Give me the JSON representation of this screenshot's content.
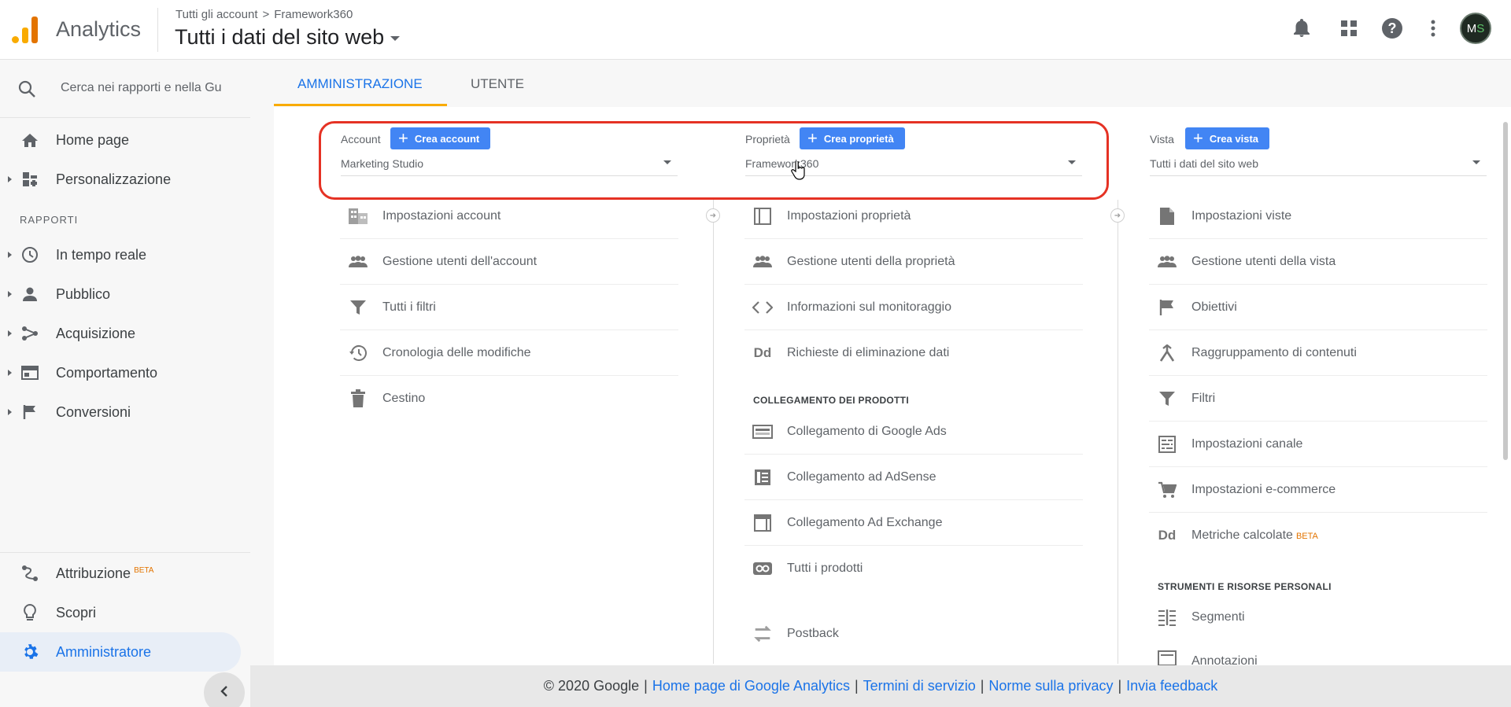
{
  "header": {
    "app_name": "Analytics",
    "breadcrumb": [
      "Tutti gli account",
      "Framework360"
    ],
    "breadcrumb_sep": ">",
    "view_title": "Tutti i dati del sito web",
    "avatar_initials": "M",
    "avatar_initials_2": "S",
    "icons": [
      "bell-icon",
      "apps-grid-icon",
      "help-icon",
      "more-vert-icon"
    ]
  },
  "sidebar": {
    "search_placeholder": "Cerca nei rapporti e nella Gu",
    "items_top": [
      {
        "label": "Home page",
        "icon": "home-icon"
      },
      {
        "label": "Personalizzazione",
        "icon": "dashboard-icon"
      }
    ],
    "section_label": "RAPPORTI",
    "items_reports": [
      {
        "label": "In tempo reale",
        "icon": "clock-icon"
      },
      {
        "label": "Pubblico",
        "icon": "person-icon"
      },
      {
        "label": "Acquisizione",
        "icon": "acquisition-icon"
      },
      {
        "label": "Comportamento",
        "icon": "behavior-icon"
      },
      {
        "label": "Conversioni",
        "icon": "flag-icon"
      }
    ],
    "items_bottom": [
      {
        "label": "Attribuzione",
        "badge": "BETA",
        "icon": "attribution-icon"
      },
      {
        "label": "Scopri",
        "icon": "lightbulb-icon"
      },
      {
        "label": "Amministratore",
        "icon": "gear-icon",
        "active": true
      }
    ]
  },
  "tabs": [
    {
      "label": "AMMINISTRAZIONE",
      "active": true
    },
    {
      "label": "UTENTE",
      "active": false
    }
  ],
  "columns": {
    "account": {
      "label": "Account",
      "create_label": "Crea account",
      "selected": "Marketing Studio",
      "items": [
        "Impostazioni account",
        "Gestione utenti dell'account",
        "Tutti i filtri",
        "Cronologia delle modifiche",
        "Cestino"
      ]
    },
    "property": {
      "label": "Proprietà",
      "create_label": "Crea proprietà",
      "selected": "Framework360",
      "items": [
        "Impostazioni proprietà",
        "Gestione utenti della proprietà",
        "Informazioni sul monitoraggio",
        "Richieste di eliminazione dati"
      ],
      "sub_head": "COLLEGAMENTO DEI PRODOTTI",
      "product_items": [
        "Collegamento di Google Ads",
        "Collegamento ad AdSense",
        "Collegamento Ad Exchange",
        "Tutti i prodotti",
        "Postback"
      ]
    },
    "view": {
      "label": "Vista",
      "create_label": "Crea vista",
      "selected": "Tutti i dati del sito web",
      "items": [
        "Impostazioni viste",
        "Gestione utenti della vista",
        "Obiettivi",
        "Raggruppamento di contenuti",
        "Filtri",
        "Impostazioni canale",
        "Impostazioni e-commerce",
        "Metriche calcolate"
      ],
      "metrics_badge": "BETA",
      "sub_head": "STRUMENTI E RISORSE PERSONALI",
      "personal_items": [
        "Segmenti",
        "Annotazioni"
      ]
    }
  },
  "footer": {
    "copyright": "© 2020 Google",
    "links": [
      "Home page di Google Analytics",
      "Termini di servizio",
      "Norme sulla privacy",
      "Invia feedback"
    ]
  },
  "colors": {
    "accent": "#1a73e8",
    "button": "#4285f4",
    "highlight": "#e53224",
    "tab_underline": "#f9ab00"
  }
}
